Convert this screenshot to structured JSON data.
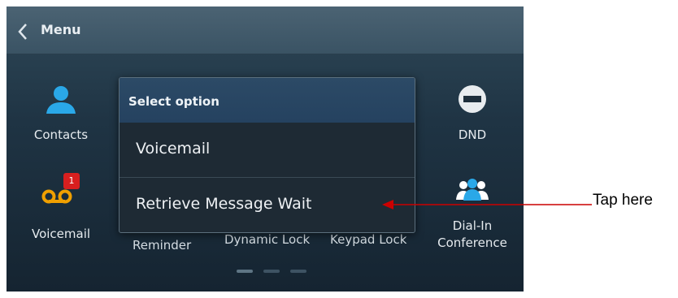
{
  "topbar": {
    "title": "Menu"
  },
  "apps": {
    "contacts": {
      "label": "Contacts"
    },
    "voicemail": {
      "label": "Voicemail",
      "badge": "1"
    },
    "dnd": {
      "label": "DND"
    },
    "dialin": {
      "label_line1": "Dial-In",
      "label_line2": "Conference"
    }
  },
  "underlying": {
    "reminder": "Reminder",
    "dynamic_lock": "Dynamic Lock",
    "keypad_lock": "Keypad Lock"
  },
  "dialog": {
    "title": "Select option",
    "options": [
      {
        "label": "Voicemail"
      },
      {
        "label": "Retrieve Message Wait"
      }
    ]
  },
  "annotation": {
    "text": "Tap here",
    "arrow_color": "#cc0000"
  },
  "colors": {
    "contacts_icon": "#2aa8e8",
    "voicemail_icon": "#f0a000",
    "badge": "#d81f1f"
  }
}
